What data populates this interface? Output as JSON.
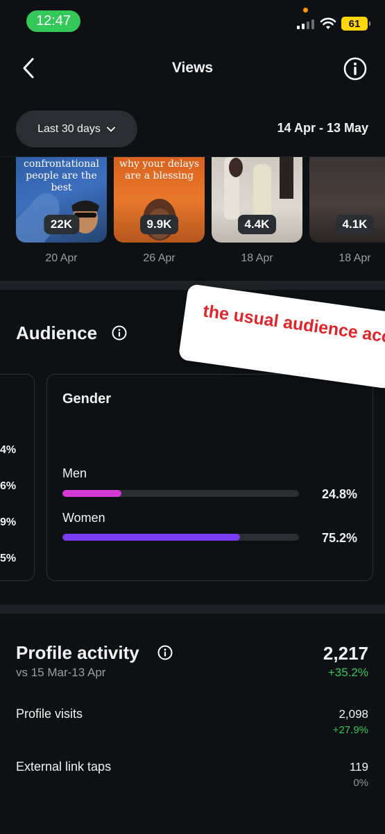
{
  "status_bar": {
    "time": "12:47",
    "battery": "61",
    "battery_color": "#ffd60a",
    "time_pill_color": "#34c759"
  },
  "header": {
    "title": "Views"
  },
  "filters": {
    "range_label": "Last 30 days",
    "date_range": "14 Apr - 13 May"
  },
  "thumbnails": [
    {
      "caption": "confrontational people are the best",
      "views": "22K",
      "date": "20 Apr"
    },
    {
      "caption": "why your delays are a blessing",
      "views": "9.9K",
      "date": "26 Apr"
    },
    {
      "caption": "",
      "views": "4.4K",
      "date": "18 Apr"
    },
    {
      "caption": "",
      "views": "4.1K",
      "date": "18 Apr"
    }
  ],
  "audience": {
    "title": "Audience",
    "left_card_percentages": [
      "4%",
      "6%",
      "9%",
      "5%"
    ],
    "gender": {
      "title": "Gender",
      "rows": [
        {
          "label": "Men",
          "value": "24.8%",
          "fraction": 0.248,
          "color": "#d63ad6"
        },
        {
          "label": "Women",
          "value": "75.2%",
          "fraction": 0.752,
          "color": "#7a3cf0"
        }
      ]
    }
  },
  "sticker": {
    "text": "the usual audience acc"
  },
  "profile_activity": {
    "title": "Profile activity",
    "comparison": "vs 15 Mar-13 Apr",
    "total": "2,217",
    "change": "+35.2%",
    "rows": [
      {
        "label": "Profile visits",
        "value": "2,098",
        "change": "+27.9%",
        "change_color": "#34c759"
      },
      {
        "label": "External link taps",
        "value": "119",
        "change": "0%",
        "change_color": "#8e9196"
      }
    ]
  }
}
